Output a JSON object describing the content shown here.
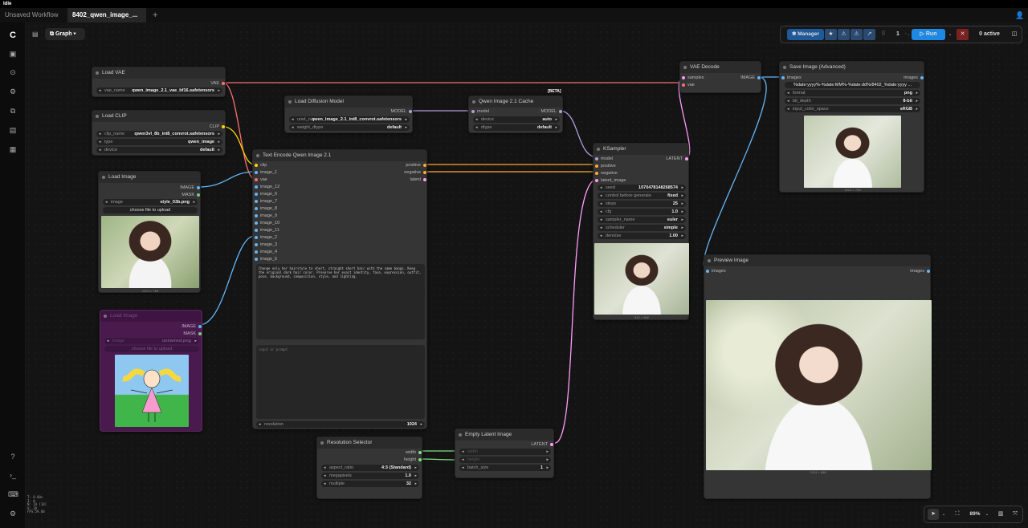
{
  "window": {
    "title": "Idle"
  },
  "tabs": [
    {
      "label": "Unsaved Workflow"
    },
    {
      "label": "8402_qwen_image_..."
    }
  ],
  "header": {
    "graph_label": "Graph"
  },
  "toolbar": {
    "manager": "Manager",
    "queue_count": "1",
    "run": "Run",
    "active": "0 active"
  },
  "zoom": "89%",
  "stats": {
    "t": "T: 0.00s",
    "i": "I: 0",
    "n": "N: 18 [18]",
    "v": "V: 39",
    "fps": "FPS:59.88"
  },
  "nodes": {
    "load_vae": {
      "title": "Load VAE",
      "out": "VAE",
      "w_label": "vae_name",
      "w_value": "qwen_image_2.1_vae_bf16.safetensors"
    },
    "load_clip": {
      "title": "Load CLIP",
      "out": "CLIP",
      "w1_label": "clip_name",
      "w1_value": "qwen3vl_8b_int8_convrot.safetensors",
      "w2_label": "type",
      "w2_value": "qwen_image",
      "w3_label": "device",
      "w3_value": "default"
    },
    "load_image": {
      "title": "Load Image",
      "out1": "IMAGE",
      "out2": "MASK",
      "w_label": "image",
      "w_value": "style_03b.png",
      "upload": "choose file to upload",
      "size": "1024 × 768"
    },
    "load_image2": {
      "title": "Load Image",
      "out1": "IMAGE",
      "out2": "MASK",
      "w_label": "image",
      "w_value": "unnamed.png",
      "upload": "choose file to upload"
    },
    "load_diffusion": {
      "title": "Load Diffusion Model",
      "out": "MODEL",
      "w1_label": "unet_n...",
      "w1_value": "qwen_image_2.1_int8_convrot.safetensors",
      "w2_label": "weight_dtype",
      "w2_value": "default"
    },
    "qwen_cache": {
      "title": "Qwen Image 2.1 Cache",
      "badge": "[BETA]",
      "in": "model",
      "out": "MODEL",
      "w1_label": "device",
      "w1_value": "auto",
      "w2_label": "dtype",
      "w2_value": "default"
    },
    "text_encode": {
      "title": "Text Encode Qwen Image 2.1",
      "inputs": [
        "clip",
        "image_1",
        "vae",
        "image_12",
        "image_6",
        "image_7",
        "image_8",
        "image_9",
        "image_10",
        "image_11",
        "image_2",
        "image_3",
        "image_4",
        "image_5"
      ],
      "outputs": [
        "positive",
        "negative",
        "latent"
      ],
      "prompt": "Change only her hairstyle to short, straight short hair with the same bangs. Keep the original dark hair color. Preserve her exact identity, face, expression, outfit, pose, background, composition, style, and lighting.",
      "negative_placeholder": "input or prompt",
      "w_label": "resolution",
      "w_value": "1024"
    },
    "ksampler": {
      "title": "KSampler",
      "inputs": [
        "model",
        "positive",
        "negative",
        "latent_image"
      ],
      "out": "LATENT",
      "widgets": [
        {
          "label": "seed",
          "value": "1070478148268574"
        },
        {
          "label": "control before generate",
          "value": "fixed"
        },
        {
          "label": "steps",
          "value": "25"
        },
        {
          "label": "cfg",
          "value": "1.0"
        },
        {
          "label": "sampler_name",
          "value": "euler"
        },
        {
          "label": "scheduler",
          "value": "simple"
        },
        {
          "label": "denoise",
          "value": "1.00"
        }
      ],
      "size": "512 × 382"
    },
    "vae_decode": {
      "title": "VAE Decode",
      "in1": "samples",
      "in2": "vae",
      "out": "IMAGE"
    },
    "save_image": {
      "title": "Save Image (Advanced)",
      "in": "images",
      "out": "images",
      "filename": "%date:yyyy%-%date:MM%-%date:dd%/8402_%date:yyyy ...",
      "w1_label": "format",
      "w1_value": "png",
      "w2_label": "bit_depth",
      "w2_value": "8-bit",
      "w3_label": "input_color_space",
      "w3_value": "sRGB",
      "size": "1024 × 768"
    },
    "preview": {
      "title": "Preview Image",
      "in": "images",
      "out": "images",
      "size": "1024 × 688"
    },
    "resolution": {
      "title": "Resolution Selector",
      "out1": "width",
      "out2": "height",
      "w1_label": "aspect_ratio",
      "w1_value": "4:3 (Standard)",
      "w2_label": "megapixels",
      "w2_value": "1.0",
      "w3_label": "multiple",
      "w3_value": "32"
    },
    "empty_latent": {
      "title": "Empty Latent Image",
      "out": "LATENT",
      "in1": "width",
      "in2": "height",
      "w_label": "batch_size",
      "w_value": "1"
    }
  },
  "colors": {
    "vae": "#ff6e6e",
    "clip": "#ffd500",
    "image": "#64b5f6",
    "model": "#b39ddb",
    "conditioning": "#ffa931",
    "latent": "#ff9cf9",
    "int": "#7fe07f",
    "run": "#1e88e5"
  }
}
